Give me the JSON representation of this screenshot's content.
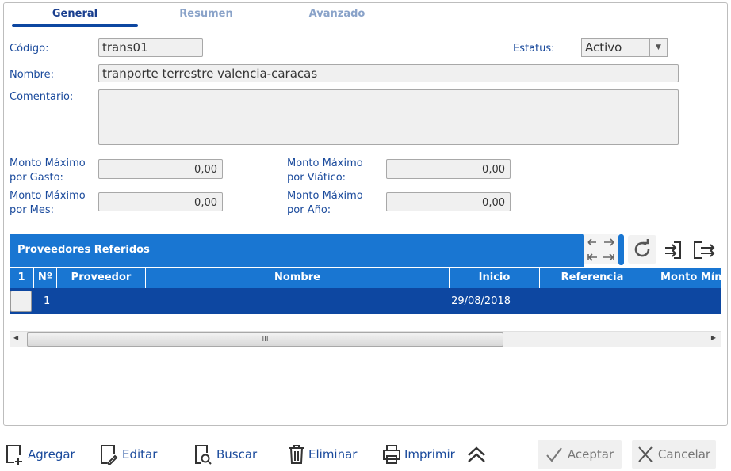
{
  "tabs": [
    "General",
    "Resumen",
    "Avanzado"
  ],
  "form": {
    "codigo_label": "Código:",
    "codigo": "trans01",
    "estatus_label": "Estatus:",
    "estatus": "Activo",
    "nombre_label": "Nombre:",
    "nombre": "tranporte terrestre valencia-caracas",
    "comentario_label": "Comentario:",
    "comentario": "",
    "gasto_l1": "Monto Máximo",
    "gasto_l2": "por Gasto:",
    "gasto": "0,00",
    "viatico_l1": "Monto Máximo",
    "viatico_l2": "por Viático:",
    "viatico": "0,00",
    "mes_l1": "Monto Máximo",
    "mes_l2": "por Mes:",
    "mes": "0,00",
    "anio_l1": "Monto Máximo",
    "anio_l2": "por Año:",
    "anio": "0,00"
  },
  "grid": {
    "title": "Proveedores Referidos",
    "columns": [
      "1",
      "Nº",
      "Proveedor",
      "Nombre",
      "Inicio",
      "Referencia",
      "Monto Míni"
    ],
    "rows": [
      {
        "n": "1",
        "proveedor": "",
        "nombre": "",
        "inicio": "29/08/2018",
        "referencia": ""
      }
    ],
    "scroll_grip": "III"
  },
  "toolbar": {
    "agregar": "Agregar",
    "editar": "Editar",
    "buscar": "Buscar",
    "eliminar": "Eliminar",
    "imprimir": "Imprimir",
    "aceptar": "Aceptar",
    "cancelar": "Cancelar"
  }
}
